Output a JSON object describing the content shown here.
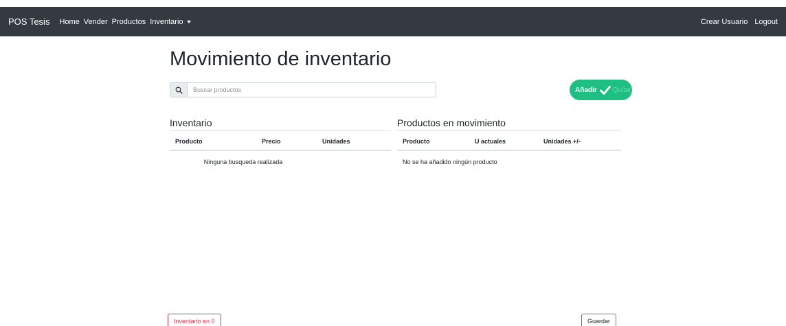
{
  "navbar": {
    "brand": "POS Tesis",
    "links": {
      "home": "Home",
      "sell": "Vender",
      "products": "Productos",
      "inventory": "Inventario"
    },
    "right": {
      "create_user": "Crear Usuario",
      "logout": "Logout"
    },
    "background_color": "#343a40"
  },
  "page": {
    "title": "Movimiento de inventario"
  },
  "search": {
    "placeholder": "Buscar productos",
    "value": "",
    "icon": "search-icon"
  },
  "toggle": {
    "on_label": "Añadir",
    "off_label": "Quitar",
    "state": "on",
    "color": "#1fbf84"
  },
  "inventory": {
    "title": "Inventario",
    "columns": [
      "Producto",
      "Precio",
      "Unidades"
    ],
    "empty_message": "Ninguna busqueda realizada"
  },
  "movement": {
    "title": "Productos en movimiento",
    "columns": [
      "Producto",
      "U actuales",
      "Unidades +/-"
    ],
    "empty_message": "No se ha añadido ningún producto"
  },
  "buttons": {
    "zero_inventory": "Inventario en 0",
    "save": "Guardar"
  },
  "colors": {
    "danger": "#dc3545",
    "secondary": "#6c757d"
  }
}
